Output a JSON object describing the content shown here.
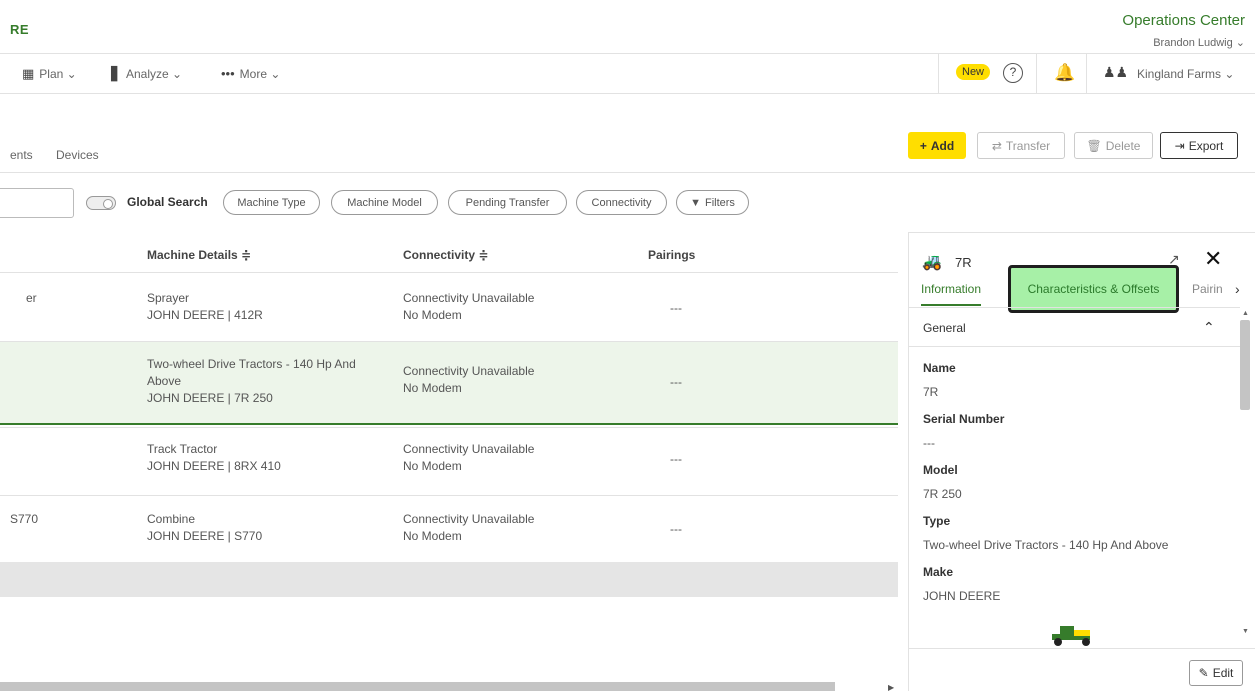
{
  "header": {
    "brand": "RE",
    "title": "Operations Center",
    "user": "Brandon Ludwig ⌄"
  },
  "nav": {
    "items": [
      {
        "label": "Plan ⌄",
        "icon": "plan-icon"
      },
      {
        "label": "Analyze ⌄",
        "icon": "analyze-icon"
      },
      {
        "label": "More ⌄",
        "icon": "more-icon"
      }
    ],
    "new_badge": "New",
    "organization": "Kingland Farms ⌄"
  },
  "page_tabs": [
    "ents",
    "Devices"
  ],
  "actions": {
    "add": "Add",
    "transfer": "Transfer",
    "delete": "Delete",
    "export": "Export"
  },
  "filters": {
    "global_search": "Global Search",
    "chips": [
      "Machine Type",
      "Machine Model",
      "Pending Transfer",
      "Connectivity",
      "Filters"
    ]
  },
  "table": {
    "columns": [
      "Machine Details ≑",
      "Connectivity ≑",
      "Pairings"
    ],
    "rows": [
      {
        "name": "er",
        "type": "Sprayer",
        "model": "JOHN DEERE | 412R",
        "conn": "Connectivity Unavailable",
        "modem": "No Modem",
        "pairings": "---"
      },
      {
        "name": "",
        "type": "Two-wheel Drive Tractors - 140 Hp And Above",
        "model": "JOHN DEERE | 7R 250",
        "conn": "Connectivity Unavailable",
        "modem": "No Modem",
        "pairings": "---"
      },
      {
        "name": "",
        "type": "Track Tractor",
        "model": "JOHN DEERE | 8RX 410",
        "conn": "Connectivity Unavailable",
        "modem": "No Modem",
        "pairings": "---"
      },
      {
        "name": "S770",
        "type": "Combine",
        "model": "JOHN DEERE | S770",
        "conn": "Connectivity Unavailable",
        "modem": "No Modem",
        "pairings": "---"
      }
    ]
  },
  "panel": {
    "title": "7R",
    "tabs": [
      "Information",
      "Characteristics & Offsets",
      "Pairin"
    ],
    "section": "General",
    "fields": [
      {
        "label": "Name",
        "value": "7R"
      },
      {
        "label": "Serial Number",
        "value": "---"
      },
      {
        "label": "Model",
        "value": "7R 250"
      },
      {
        "label": "Type",
        "value": "Two-wheel Drive Tractors - 140 Hp And Above"
      },
      {
        "label": "Make",
        "value": "JOHN DEERE"
      }
    ],
    "edit": "Edit"
  },
  "colors": {
    "brand_green": "#367c2b",
    "accent_yellow": "#ffde00",
    "highlight_green": "#a7f0a7",
    "selected_row": "#edf5ea"
  }
}
